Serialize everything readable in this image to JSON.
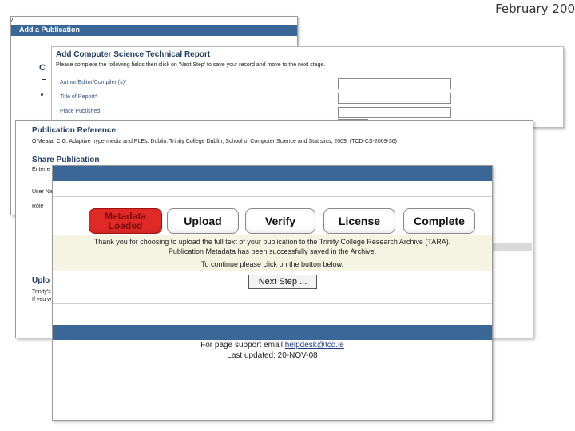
{
  "header_date": "February 200",
  "win1": {
    "title": "Add a Publication",
    "side_letter": "C",
    "top_mark": "/"
  },
  "win2": {
    "heading": "Add Computer Science Technical Report",
    "instructions": "Please complete the following fields then click on 'Next Step' to save your record and move to the next stage.",
    "fields": [
      "Author/Editor/Compiler (s)*",
      "Title of Report*",
      "Place Published"
    ]
  },
  "win3": {
    "heading1": "Publication Reference",
    "reference": "O'Meara, C.G. Adaptive hypermedia and PLEs. Dublin: Trinity College Dublin, School of Computer Science and Statistics, 2009. (TCD-CS-2009-36)",
    "heading2": "Share Publication",
    "enter": "Enter e",
    "user": "User Na",
    "role": "Role",
    "upload_heading": "Uplo",
    "trinity": "Trinity's",
    "ifyou": "If you w"
  },
  "wizard": {
    "steps": [
      "Metadata Loaded",
      "Upload",
      "Verify",
      "License",
      "Complete"
    ],
    "active_line1": "Metadata",
    "active_line2": "Loaded",
    "message_line1": "Thank you for choosing to upload the full text of your publication to the Trinity College Research Archive (TARA).",
    "message_line2": "Publication Metadata has been successfully saved in the Archive.",
    "continue_text": "To continue please click on the button below.",
    "next_button": "Next Step ...",
    "support_prefix": "For page support email ",
    "support_email": "helpdesk@tcd.ie",
    "last_updated": "Last updated: 20-NOV-08"
  },
  "colors": {
    "header_blue": "#3a6797",
    "active_step": "#e02a27",
    "message_bg": "#f5f4e3",
    "delete_red": "#c0201a"
  },
  "icons": {
    "delete": "delete-x-icon"
  }
}
